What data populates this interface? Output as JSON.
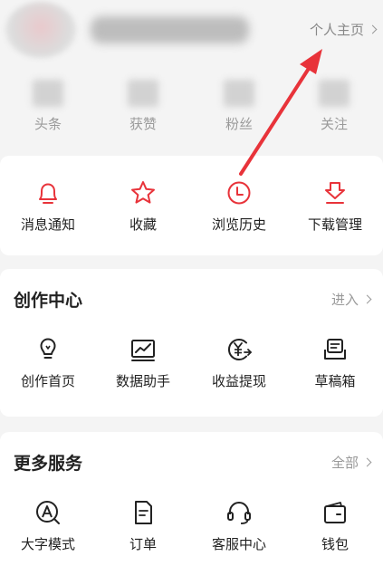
{
  "profile": {
    "homepage_link": "个人主页"
  },
  "stats": [
    {
      "label": "头条"
    },
    {
      "label": "获赞"
    },
    {
      "label": "粉丝"
    },
    {
      "label": "关注"
    }
  ],
  "quick_actions": [
    {
      "label": "消息通知",
      "icon": "bell-icon"
    },
    {
      "label": "收藏",
      "icon": "star-icon"
    },
    {
      "label": "浏览历史",
      "icon": "clock-icon"
    },
    {
      "label": "下载管理",
      "icon": "download-icon"
    }
  ],
  "creator_center": {
    "title": "创作中心",
    "more": "进入",
    "items": [
      {
        "label": "创作首页",
        "icon": "lightbulb-icon"
      },
      {
        "label": "数据助手",
        "icon": "line-chart-icon"
      },
      {
        "label": "收益提现",
        "icon": "yuan-coin-icon"
      },
      {
        "label": "草稿箱",
        "icon": "draft-box-icon"
      }
    ]
  },
  "more_services": {
    "title": "更多服务",
    "more": "全部",
    "items": [
      {
        "label": "大字模式",
        "icon": "font-size-icon"
      },
      {
        "label": "订单",
        "icon": "order-icon"
      },
      {
        "label": "客服中心",
        "icon": "headset-icon"
      },
      {
        "label": "钱包",
        "icon": "wallet-icon"
      }
    ]
  },
  "colors": {
    "accent_red": "#e8333a",
    "background": "#f4f4f4",
    "card": "#ffffff",
    "text_primary": "#222222",
    "text_secondary": "#999999"
  }
}
